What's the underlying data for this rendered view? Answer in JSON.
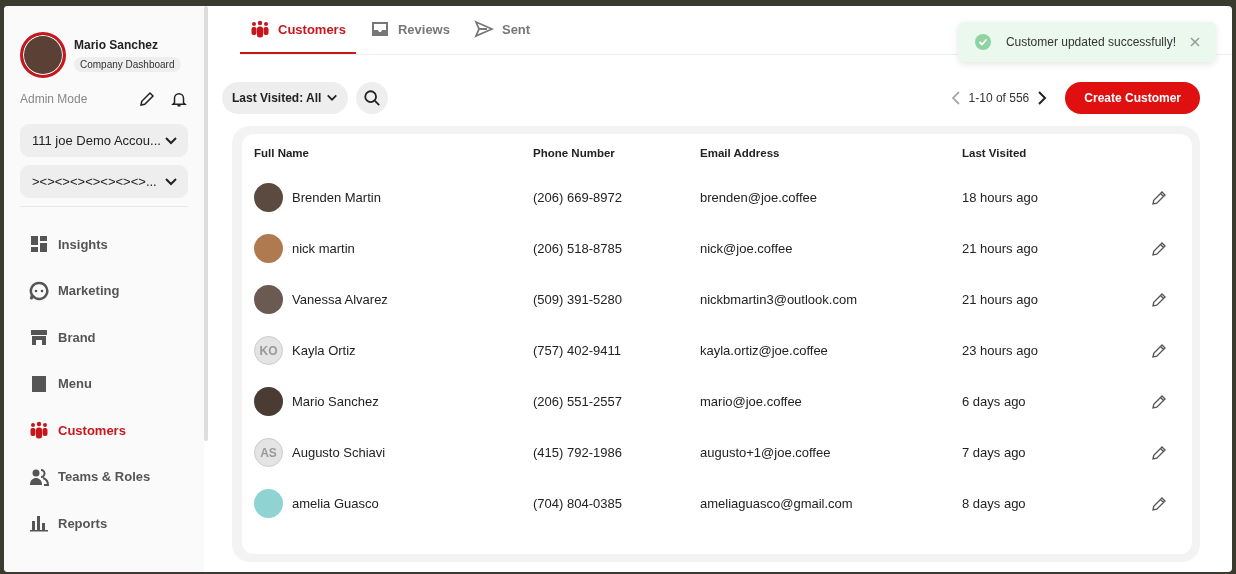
{
  "profile": {
    "name": "Mario Sanchez",
    "badge": "Company Dashboard",
    "mode": "Admin Mode"
  },
  "selectors": [
    {
      "value": "111 joe Demo Accou..."
    },
    {
      "value": "><><><><><><><>..."
    }
  ],
  "nav": [
    {
      "label": "Insights",
      "selected": false
    },
    {
      "label": "Marketing",
      "selected": false
    },
    {
      "label": "Brand",
      "selected": false
    },
    {
      "label": "Menu",
      "selected": false
    },
    {
      "label": "Customers",
      "selected": true
    },
    {
      "label": "Teams & Roles",
      "selected": false
    },
    {
      "label": "Reports",
      "selected": false
    }
  ],
  "tabs": [
    {
      "label": "Customers",
      "selected": true
    },
    {
      "label": "Reviews",
      "selected": false
    },
    {
      "label": "Sent",
      "selected": false
    }
  ],
  "filter": {
    "label": "Last Visited: All"
  },
  "pagination": {
    "range": "1-10 of 556"
  },
  "create_button": "Create Customer",
  "toast": {
    "message": "Customer updated successfully!"
  },
  "table": {
    "columns": [
      "Full Name",
      "Phone Number",
      "Email Address",
      "Last Visited"
    ],
    "rows": [
      {
        "avatar": {
          "kind": "photo",
          "color": "#5a4a3f"
        },
        "name": "Brenden Martin",
        "phone": "(206) 669-8972",
        "email": "brenden@joe.coffee",
        "last_visited": "18 hours ago"
      },
      {
        "avatar": {
          "kind": "photo",
          "color": "#b07a50"
        },
        "name": "nick martin",
        "phone": "(206) 518-8785",
        "email": "nick@joe.coffee",
        "last_visited": "21 hours ago"
      },
      {
        "avatar": {
          "kind": "photo",
          "color": "#6b5a52"
        },
        "name": "Vanessa Alvarez",
        "phone": "(509) 391-5280",
        "email": "nickbmartin3@outlook.com",
        "last_visited": "21 hours ago"
      },
      {
        "avatar": {
          "kind": "initials",
          "initials": "KO"
        },
        "name": "Kayla Ortiz",
        "phone": "(757) 402-9411",
        "email": "kayla.ortiz@joe.coffee",
        "last_visited": "23 hours ago"
      },
      {
        "avatar": {
          "kind": "photo",
          "color": "#4a3b33"
        },
        "name": "Mario Sanchez",
        "phone": "(206) 551-2557",
        "email": "mario@joe.coffee",
        "last_visited": "6 days ago"
      },
      {
        "avatar": {
          "kind": "initials",
          "initials": "AS"
        },
        "name": "Augusto Schiavi",
        "phone": "(415) 792-1986",
        "email": "augusto+1@joe.coffee",
        "last_visited": "7 days ago"
      },
      {
        "avatar": {
          "kind": "photo",
          "color": "#8fd3d3"
        },
        "name": "amelia Guasco",
        "phone": "(704) 804-0385",
        "email": "ameliaguasco@gmail.com",
        "last_visited": "8 days ago"
      }
    ]
  }
}
